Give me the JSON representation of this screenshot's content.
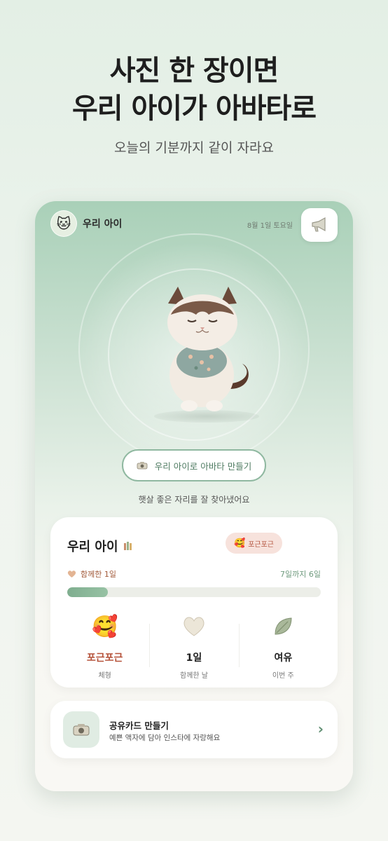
{
  "hero": {
    "title_line1": "사진 한 장이면",
    "title_line2": "우리 아이가 아바타로",
    "subtitle": "오늘의 기분까지 같이 자라요"
  },
  "app": {
    "header": {
      "pet_name": "우리 아이",
      "avatar_icon": "cat-face-icon",
      "date": "8월 1일 토요일",
      "announce_icon": "megaphone-icon"
    },
    "make_avatar_button": {
      "label": "우리 아이로 아바타 만들기",
      "icon": "camera-icon"
    },
    "status_message": "햇살 좋은 자리를 잘 찾아냈어요",
    "pet_card": {
      "name": "우리 아이",
      "name_icon": "crayons-icon",
      "mood_badge": "포근포근",
      "together_label": "함께한 1일",
      "until_label": "7일까지 6일",
      "progress": 0.16,
      "stats": [
        {
          "value": "포근포근",
          "label": "체형",
          "icon": "smiling-hearts-icon"
        },
        {
          "value": "1일",
          "label": "함께한 날",
          "icon": "heart-icon"
        },
        {
          "value": "여유",
          "label": "이번 주",
          "icon": "leaf-icon"
        }
      ]
    },
    "share_card": {
      "title": "공유카드 만들기",
      "description": "예쁜 액자에 담아 인스타에 자랑해요",
      "chevron": "›"
    }
  },
  "colors": {
    "accent_green": "#8fb8a0",
    "mood_red": "#b5523a",
    "progress_fill": "#7fae8f"
  }
}
